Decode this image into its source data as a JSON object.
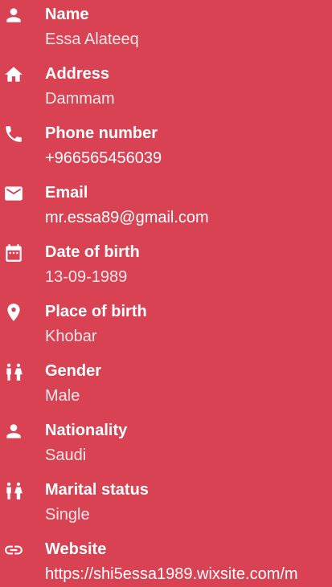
{
  "colors": {
    "background": "#d94253",
    "text": "#ffffff"
  },
  "profile": {
    "items": [
      {
        "icon": "person-icon",
        "label": "Name",
        "value": "Essa Alateeq"
      },
      {
        "icon": "home-icon",
        "label": "Address",
        "value": "Dammam"
      },
      {
        "icon": "phone-icon",
        "label": "Phone number",
        "value": "+966565456039"
      },
      {
        "icon": "email-icon",
        "label": "Email",
        "value": "mr.essa89@gmail.com"
      },
      {
        "icon": "calendar-icon",
        "label": "Date of birth",
        "value": "13-09-1989"
      },
      {
        "icon": "location-pin-icon",
        "label": "Place of birth",
        "value": "Khobar"
      },
      {
        "icon": "people-icon",
        "label": "Gender",
        "value": "Male"
      },
      {
        "icon": "person-icon",
        "label": "Nationality",
        "value": "Saudi"
      },
      {
        "icon": "people-icon",
        "label": "Marital status",
        "value": "Single"
      },
      {
        "icon": "link-icon",
        "label": "Website",
        "value": "https://shi5essa1989.wixsite.com/m"
      }
    ]
  }
}
